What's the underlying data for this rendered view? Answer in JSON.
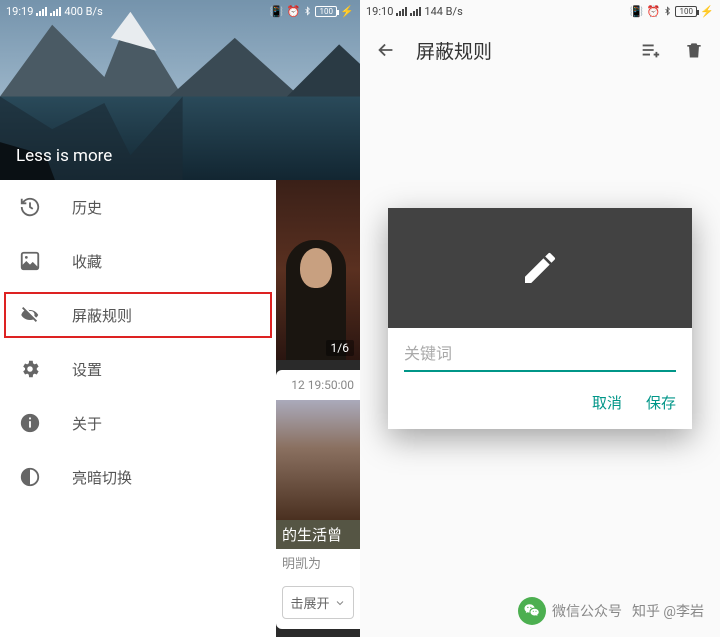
{
  "left": {
    "status": {
      "time": "19:19",
      "net": "400 B/s",
      "battery": "100"
    },
    "drawer": {
      "title": "Less is more",
      "items": [
        {
          "icon": "history-icon",
          "label": "历史"
        },
        {
          "icon": "collection-icon",
          "label": "收藏"
        },
        {
          "icon": "block-icon",
          "label": "屏蔽规则"
        },
        {
          "icon": "settings-icon",
          "label": "设置"
        },
        {
          "icon": "info-icon",
          "label": "关于"
        },
        {
          "icon": "theme-icon",
          "label": "亮暗切换"
        }
      ]
    },
    "behind": {
      "counter": "1/6",
      "timestamp": "12 19:50:00",
      "caption": "的生活曾",
      "expand": "击展开",
      "subcaption": "明凯为"
    }
  },
  "right": {
    "status": {
      "time": "19:10",
      "net": "144 B/s",
      "battery": "100"
    },
    "toolbar": {
      "title": "屏蔽规则"
    },
    "dialog": {
      "placeholder": "关键词",
      "cancel": "取消",
      "save": "保存"
    }
  },
  "watermark": {
    "text1": "微信公众号",
    "text2": "知乎 @李岩"
  }
}
